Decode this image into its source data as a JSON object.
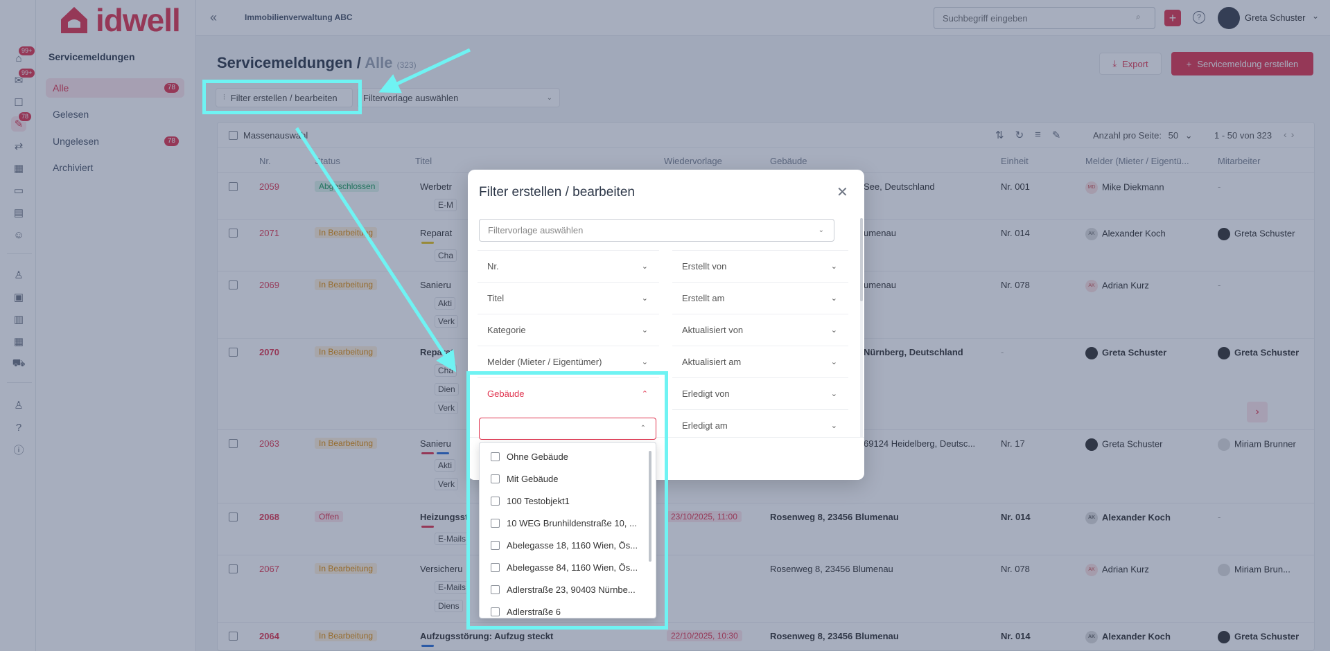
{
  "rail": {
    "badges": [
      "99+",
      "99+",
      "78"
    ]
  },
  "nav": {
    "logo_text": "idwell",
    "title": "Servicemeldungen",
    "items": [
      {
        "label": "Alle",
        "count": "78"
      },
      {
        "label": "Gelesen",
        "count": ""
      },
      {
        "label": "Ungelesen",
        "count": "78"
      },
      {
        "label": "Archiviert",
        "count": ""
      }
    ]
  },
  "topbar": {
    "org_name": "Immobilienverwaltung ABC",
    "search_placeholder": "Suchbegriff eingeben",
    "user_name": "Greta Schuster"
  },
  "page": {
    "title": "Servicemeldungen / ",
    "title_sub": "Alle",
    "title_count": "(323)",
    "export_label": "Export",
    "create_label": "Servicemeldung erstellen",
    "filter_btn_label": "Filter erstellen / bearbeiten",
    "filter_template_label": "Filtervorlage auswählen"
  },
  "table": {
    "mass_select": "Massenauswahl",
    "per_page_label": "Anzahl pro Seite:",
    "per_page_value": "50",
    "range": "1 - 50 von 323",
    "columns": [
      "Nr.",
      "Status",
      "Titel",
      "Wiedervorlage",
      "Gebäude",
      "Einheit",
      "Melder (Mieter / Eigentü...",
      "Mitarbeiter"
    ],
    "rows": [
      {
        "nr": "2059",
        "status": "Abgeschlossen",
        "title": "Werbetr",
        "sub": "E-M",
        "due": "",
        "building": "See, Deutschland",
        "unit": "Nr. 001",
        "reporter": "Mike Diekmann",
        "reporter_initials": "MD",
        "employee": "-"
      },
      {
        "nr": "2071",
        "status": "In Bearbeitung",
        "title": "Reparat",
        "sub": "Cha",
        "due": "",
        "building": "umenau",
        "unit": "Nr. 014",
        "reporter": "Alexander Koch",
        "reporter_initials": "AK",
        "employee": "Greta Schuster"
      },
      {
        "nr": "2069",
        "status": "In Bearbeitung",
        "title": "Sanieru",
        "sub": "Akti",
        "sub2": "Verk",
        "due": "",
        "building": "umenau",
        "unit": "Nr. 078",
        "reporter": "Adrian Kurz",
        "reporter_initials": "AK",
        "employee": "-"
      },
      {
        "nr": "2070",
        "status": "In Bearbeitung",
        "title": "Reparat",
        "sub": "Cha",
        "sub2": "Dien",
        "sub3": "Verk",
        "due": "",
        "building": "Nürnberg, Deutschland",
        "unit": "-",
        "reporter": "Greta Schuster",
        "reporter_initials": "",
        "employee": "Greta Schuster"
      },
      {
        "nr": "2063",
        "status": "In Bearbeitung",
        "title": "Sanieru",
        "sub": "Akti",
        "sub2": "Verk",
        "due": "",
        "building": "69124 Heidelberg, Deutsc...",
        "unit": "Nr. 17",
        "reporter": "Greta Schuster",
        "reporter_initials": "",
        "employee": "Miriam Brunner"
      },
      {
        "nr": "2068",
        "status": "Offen",
        "title": "Heizungsst",
        "sub": "E-Mails",
        "due": "23/10/2025, 11:00",
        "building": "Rosenweg 8, 23456 Blumenau",
        "unit": "Nr. 014",
        "reporter": "Alexander Koch",
        "reporter_initials": "AK",
        "employee": "-"
      },
      {
        "nr": "2067",
        "status": "In Bearbeitung",
        "title": "Versicheru",
        "sub": "E-Mails",
        "sub2": "Diens",
        "due": "",
        "building": "Rosenweg 8, 23456 Blumenau",
        "unit": "Nr. 078",
        "reporter": "Adrian Kurz",
        "reporter_initials": "AK",
        "employee": "Miriam Brun..."
      },
      {
        "nr": "2064",
        "status": "In Bearbeitung",
        "title": "Aufzugsstörung: Aufzug steckt",
        "sub": "",
        "due": "22/10/2025, 10:30",
        "building": "Rosenweg 8, 23456 Blumenau",
        "unit": "Nr. 014",
        "reporter": "Alexander Koch",
        "reporter_initials": "AK",
        "employee": "Greta Schuster"
      }
    ]
  },
  "modal": {
    "title": "Filter erstellen / bearbeiten",
    "template_placeholder": "Filtervorlage auswählen",
    "left_fields": [
      "Nr.",
      "Titel",
      "Kategorie",
      "Melder (Mieter / Eigentümer)",
      "Gebäude"
    ],
    "right_fields": [
      "Erstellt von",
      "Erstellt am",
      "Aktualisiert von",
      "Aktualisiert am",
      "Erledigt von",
      "Erledigt am"
    ]
  },
  "dropdown": {
    "options": [
      "Ohne Gebäude",
      "Mit Gebäude",
      "100 Testobjekt1",
      "10 WEG Brunhildenstraße 10, ...",
      "Abelegasse 18, 1160 Wien, Ös...",
      "Abelegasse 84, 1160 Wien, Ös...",
      "Adlerstraße 23, 90403 Nürnbe...",
      "Adlerstraße 6"
    ]
  },
  "colors": {
    "accent": "#e0344f",
    "annotation": "#6ff3f3",
    "overlay": "#2d3e64"
  }
}
